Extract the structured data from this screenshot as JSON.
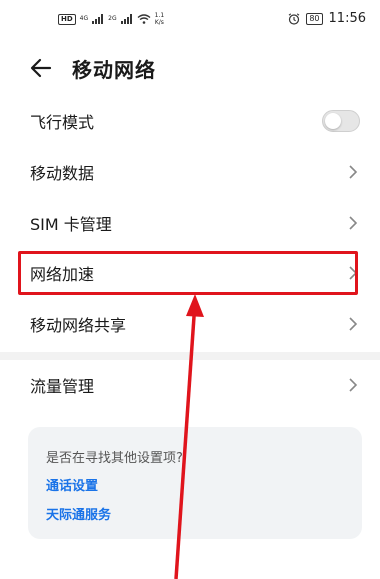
{
  "status_bar": {
    "hd": "HD",
    "net1": "4G",
    "net2": "2G",
    "speed_value": "1.1",
    "speed_unit": "K/s",
    "battery": "80",
    "time": "11:56"
  },
  "header": {
    "title": "移动网络"
  },
  "items": [
    {
      "label": "飞行模式",
      "type": "toggle",
      "on": false
    },
    {
      "label": "移动数据",
      "type": "chevron"
    },
    {
      "label": "SIM 卡管理",
      "type": "chevron"
    },
    {
      "label": "网络加速",
      "type": "chevron"
    },
    {
      "label": "移动网络共享",
      "type": "chevron"
    },
    {
      "label": "流量管理",
      "type": "chevron"
    }
  ],
  "suggest": {
    "question": "是否在寻找其他设置项?",
    "links": [
      "通话设置",
      "天际通服务"
    ]
  },
  "colors": {
    "link": "#1a73e8",
    "annotation": "#e0141c"
  }
}
